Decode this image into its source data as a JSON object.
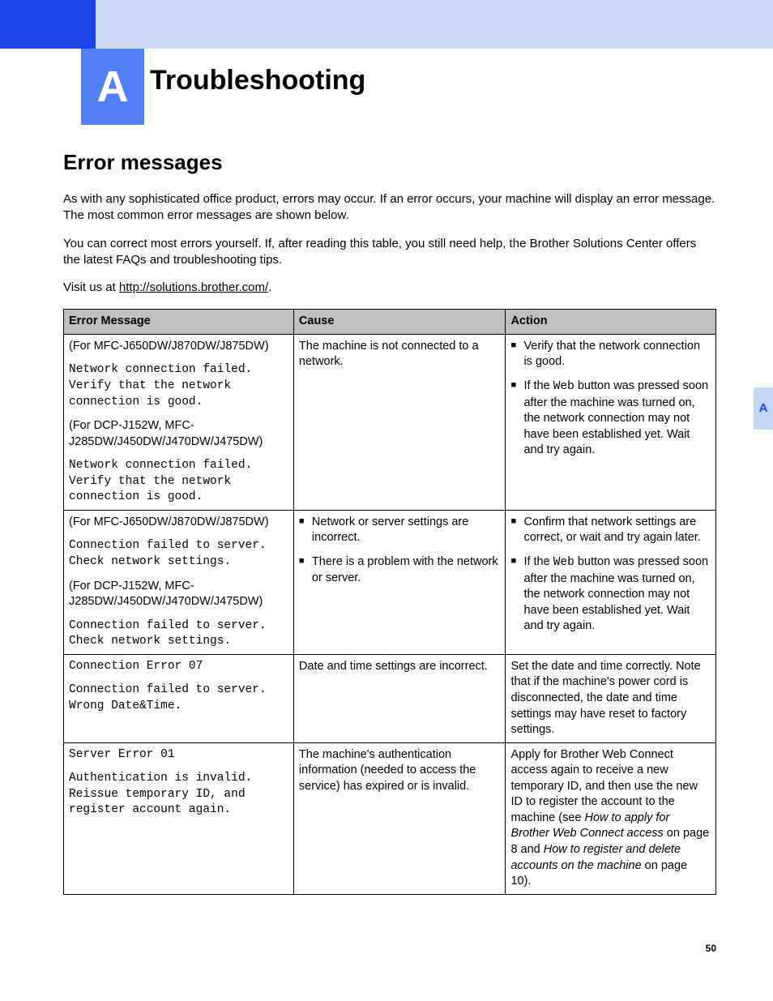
{
  "appendix_letter": "A",
  "chapter_title": "Troubleshooting",
  "side_tab": "A",
  "page_number": "50",
  "section_heading": "Error messages",
  "intro_para1": "As with any sophisticated office product, errors may occur. If an error occurs, your machine will display an error message. The most common error messages are shown below.",
  "intro_para2": "You can correct most errors yourself. If, after reading this table, you still need help, the Brother Solutions Center offers the latest FAQs and troubleshooting tips.",
  "visit_prefix": "Visit us at ",
  "visit_link": "http://solutions.brother.com/",
  "visit_suffix": ".",
  "table": {
    "headers": {
      "msg": "Error Message",
      "cause": "Cause",
      "action": "Action"
    },
    "rows": [
      {
        "msg": {
          "label_a": "(For MFC-J650DW/J870DW/J875DW)",
          "code_a": "Network connection failed. Verify that the network connection is good.",
          "label_b": "(For DCP-J152W, MFC-J285DW/J450DW/J470DW/J475DW)",
          "code_b": "Network connection failed. Verify that the network connection is good."
        },
        "cause_plain": "The machine is not connected to a network.",
        "action_bullets": {
          "b1": "Verify that the network connection is good.",
          "b2_pre": "If the ",
          "b2_code": "Web",
          "b2_post": " button was pressed soon after the machine was turned on, the network connection may not have been established yet. Wait and try again."
        }
      },
      {
        "msg": {
          "label_a": "(For MFC-J650DW/J870DW/J875DW)",
          "code_a": "Connection failed to server. Check network settings.",
          "label_b": "(For DCP-J152W, MFC-J285DW/J450DW/J470DW/J475DW)",
          "code_b": "Connection failed to server. Check network settings."
        },
        "cause_bullets": {
          "b1": "Network or server settings are incorrect.",
          "b2": "There is a problem with the network or server."
        },
        "action_bullets": {
          "b1": "Confirm that network settings are correct, or wait and try again later.",
          "b2_pre": "If the ",
          "b2_code": "Web",
          "b2_post": " button was pressed soon after the machine was turned on, the network connection may not have been established yet. Wait and try again."
        }
      },
      {
        "msg": {
          "code_a": "Connection Error 07",
          "code_b": "Connection failed to server. Wrong Date&Time."
        },
        "cause_plain": "Date and time settings are incorrect.",
        "action_plain": "Set the date and time correctly. Note that if the machine's power cord is disconnected, the date and time settings may have reset to factory settings."
      },
      {
        "msg": {
          "code_a": "Server Error 01",
          "code_b": "Authentication is invalid. Reissue temporary ID, and register account again."
        },
        "cause_plain": "The machine's authentication information (needed to access the service) has expired or is invalid.",
        "action_rich": {
          "pre": "Apply for Brother Web Connect access again to receive a new temporary ID, and then use the new ID to register the account to the machine (see ",
          "it1": "How to apply for Brother Web Connect access",
          "mid": " on page 8 and ",
          "it2": "How to register and delete accounts on the machine",
          "post": " on page 10)."
        }
      }
    ]
  }
}
